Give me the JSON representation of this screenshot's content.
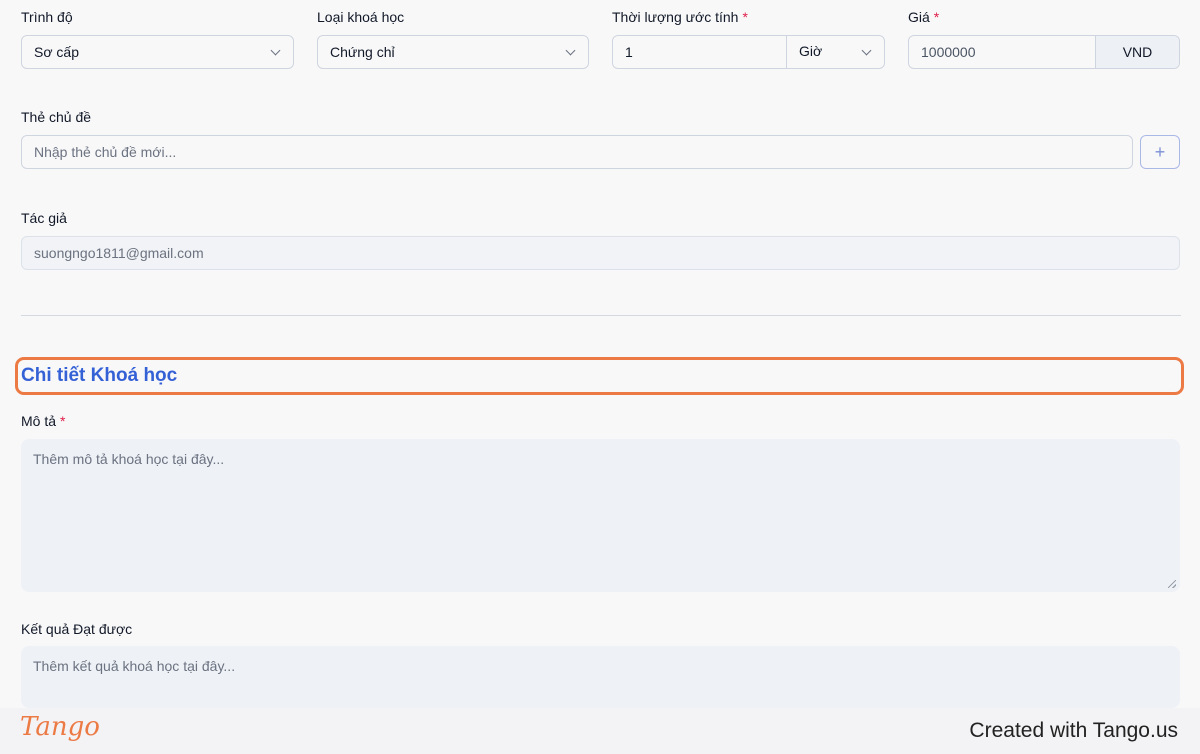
{
  "fields": {
    "level": {
      "label": "Trình độ",
      "value": "Sơ cấp"
    },
    "course_type": {
      "label": "Loại khoá học",
      "value": "Chứng chỉ"
    },
    "duration": {
      "label": "Thời lượng ước tính",
      "required": "*",
      "value": "1",
      "unit": "Giờ"
    },
    "price": {
      "label": "Giá",
      "required": "*",
      "value": "1000000",
      "currency": "VND"
    },
    "tags": {
      "label": "Thẻ chủ đề",
      "placeholder": "Nhập thẻ chủ đề mới...",
      "add_label": "+"
    },
    "author": {
      "label": "Tác giả",
      "value": "suongngo1811@gmail.com"
    }
  },
  "details": {
    "title": "Chi tiết Khoá học",
    "description": {
      "label": "Mô tả",
      "required": "*",
      "placeholder": "Thêm mô tả khoá học tại đây..."
    },
    "outcomes": {
      "label": "Kết quả Đạt được",
      "placeholder": "Thêm kết quả khoá học tại đây..."
    }
  },
  "footer": {
    "logo": "Tango",
    "created_with": "Created with Tango.us"
  },
  "colors": {
    "accent": "#3561d6",
    "highlight": "#ec7a45",
    "required": "#e11d48"
  }
}
